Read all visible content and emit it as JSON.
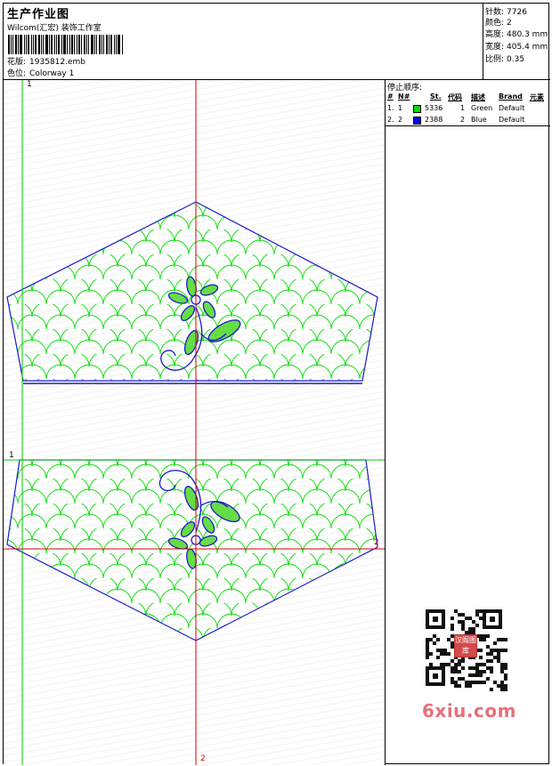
{
  "header": {
    "title": "生产作业图",
    "company": "Wilcom(汇宏) 装饰工作室",
    "design_label": "花版:",
    "design_value": "1935812.emb",
    "colorway_label": "色位:",
    "colorway_value": "Colorway 1"
  },
  "stats": [
    {
      "label": "针数:",
      "value": "7726"
    },
    {
      "label": "颜色:",
      "value": "2"
    },
    {
      "label": "高度:",
      "value": "480.3 mm"
    },
    {
      "label": "宽度:",
      "value": "405.4 mm"
    },
    {
      "label": "比例:",
      "value": "0.35"
    }
  ],
  "stop_sequence": {
    "title": "停止顺序:",
    "columns": [
      "#",
      "N#",
      "St.",
      "代码",
      "描述",
      "Brand",
      "元素"
    ],
    "rows": [
      {
        "num": "1.",
        "n": "1",
        "color": "#00dd00",
        "stitches": "5336",
        "code": "1",
        "description": "Green",
        "brand": "Default"
      },
      {
        "num": "2.",
        "n": "2",
        "color": "#0000ee",
        "stitches": "2388",
        "code": "2",
        "description": "Blue",
        "brand": "Default"
      }
    ]
  },
  "guides": {
    "label_v1": "1",
    "label_h1": "1",
    "label_h2": "2",
    "label_v2": "2"
  },
  "colors": {
    "green_thread": "#00dd00",
    "blue_thread": "#1a1acc",
    "guide_green": "#00cc00",
    "guide_red": "#dd0000"
  },
  "watermark": {
    "stamp_text": "汉阁图库",
    "site": "6xiu.com"
  }
}
